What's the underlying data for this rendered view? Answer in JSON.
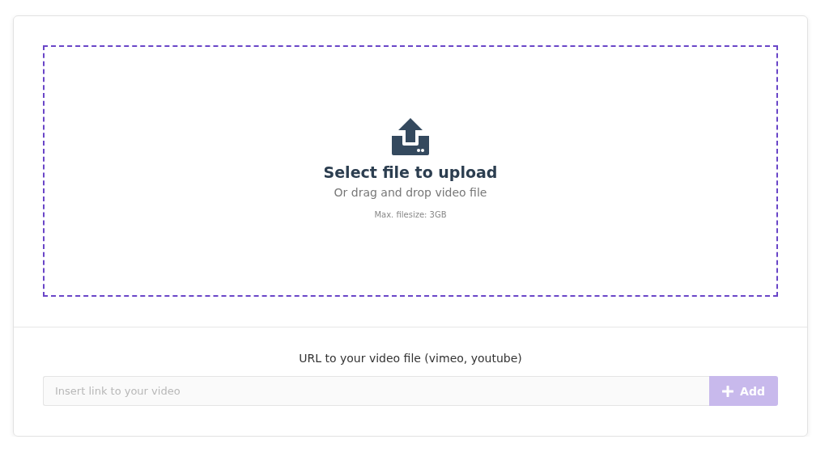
{
  "upload": {
    "title": "Select file to upload",
    "subtitle": "Or drag and drop video file",
    "note": "Max. filesize: 3GB"
  },
  "url_section": {
    "label": "URL to your video file (vimeo, youtube)",
    "input": {
      "placeholder": "Insert link to your video"
    },
    "button": {
      "label": "Add",
      "disabled": true
    }
  }
}
